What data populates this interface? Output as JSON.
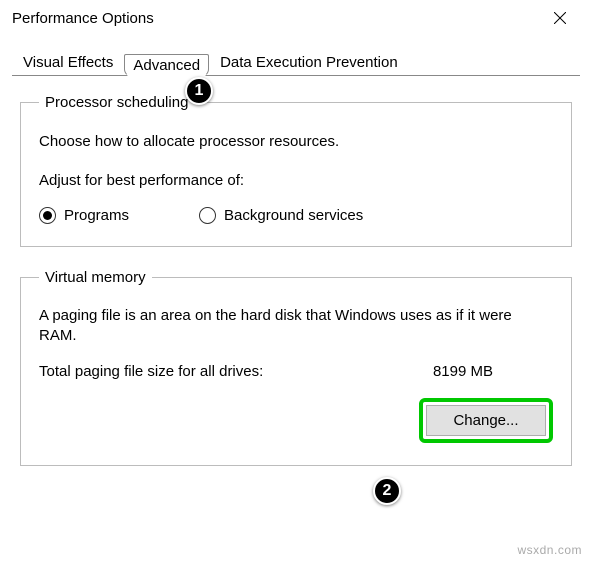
{
  "window": {
    "title": "Performance Options",
    "close_icon": "✕"
  },
  "tabs": {
    "visual_effects": "Visual Effects",
    "advanced": "Advanced",
    "dep": "Data Execution Prevention"
  },
  "processor": {
    "legend": "Processor scheduling",
    "description": "Choose how to allocate processor resources.",
    "adjust_label": "Adjust for best performance of:",
    "option_programs": "Programs",
    "option_background": "Background services",
    "selected": "programs"
  },
  "virtual_memory": {
    "legend": "Virtual memory",
    "description": "A paging file is an area on the hard disk that Windows uses as if it were RAM.",
    "total_label": "Total paging file size for all drives:",
    "total_value": "8199 MB",
    "change_button": "Change..."
  },
  "callouts": {
    "one": "1",
    "two": "2"
  },
  "watermark": "wsxdn.com"
}
